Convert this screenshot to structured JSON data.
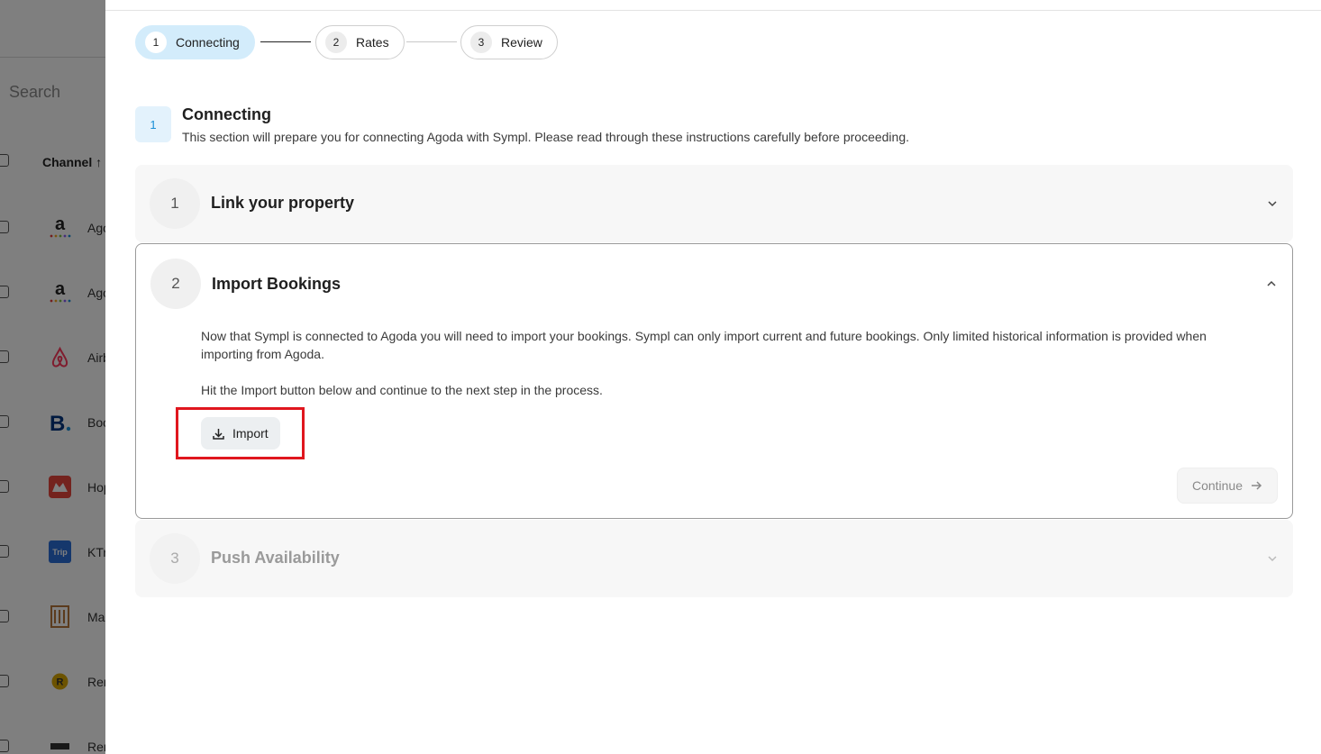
{
  "background": {
    "search_placeholder": "Search",
    "column_header": "Channel",
    "rows": [
      {
        "name": "Ago",
        "logo": "agoda-logo"
      },
      {
        "name": "Ago",
        "logo": "agoda-logo"
      },
      {
        "name": "Airb",
        "logo": "airbnb-logo"
      },
      {
        "name": "Boo",
        "logo": "booking-logo"
      },
      {
        "name": "Hop",
        "logo": "hopper-logo"
      },
      {
        "name": "KTr",
        "logo": "trip-logo"
      },
      {
        "name": "Ma",
        "logo": "ma-logo"
      },
      {
        "name": "Ren",
        "logo": "r-logo"
      },
      {
        "name": "Ren",
        "logo": "ren-logo"
      }
    ],
    "trip_logo_text": "Trip",
    "r_logo_text": "R"
  },
  "stepper": {
    "steps": [
      {
        "num": "1",
        "label": "Connecting"
      },
      {
        "num": "2",
        "label": "Rates"
      },
      {
        "num": "3",
        "label": "Review"
      }
    ]
  },
  "section": {
    "badge": "1",
    "title": "Connecting",
    "description": "This section will prepare you for connecting Agoda with Sympl. Please read through these instructions carefully before proceeding."
  },
  "accordion": [
    {
      "num": "1",
      "title": "Link your property",
      "state": "collapsed"
    },
    {
      "num": "2",
      "title": "Import Bookings",
      "state": "expanded",
      "paragraph1": "Now that Sympl is connected to Agoda you will need to import your bookings. Sympl can only import current and future bookings. Only limited historical information is provided when importing from Agoda.",
      "paragraph2": "Hit the Import button below and continue to the next step in the process.",
      "import_label": "Import",
      "continue_label": "Continue"
    },
    {
      "num": "3",
      "title": "Push Availability",
      "state": "disabled"
    }
  ],
  "colors": {
    "accent": "#1a8fd6",
    "active_step_bg": "#d3ecfb",
    "highlight": "#e0161e"
  }
}
